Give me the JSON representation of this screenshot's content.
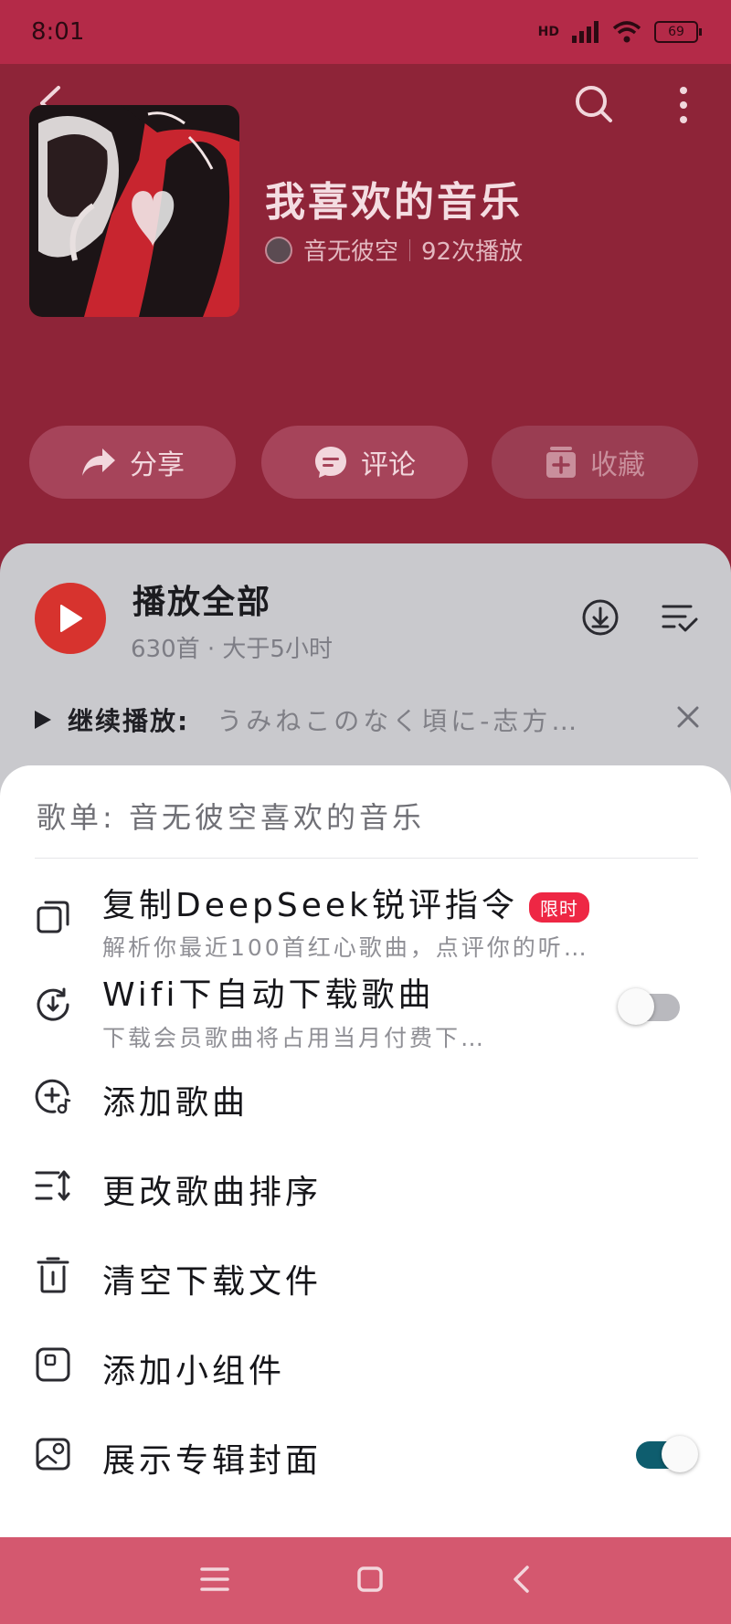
{
  "status": {
    "time": "8:01",
    "network": "HD",
    "battery": "69"
  },
  "header": {
    "playlist_title": "我喜欢的音乐",
    "creator_name": "音无彼空",
    "play_count": "92次播放",
    "actions": [
      {
        "label": "分享",
        "icon": "share-icon"
      },
      {
        "label": "评论",
        "icon": "comment-icon"
      },
      {
        "label": "收藏",
        "icon": "collect-icon"
      }
    ]
  },
  "player": {
    "play_all_label": "播放全部",
    "track_info": "630首 · 大于5小时",
    "continue_label": "继续播放:",
    "continue_song": "うみねこのなく頃に-志方…"
  },
  "menu": {
    "title": "歌单: 音无彼空喜欢的音乐",
    "items": [
      {
        "label": "复制DeepSeek锐评指令",
        "badge": "限时",
        "sub": "解析你最近100首红心歌曲，点评你的听…",
        "icon": "copy-icon"
      },
      {
        "label": "Wifi下自动下载歌曲",
        "sub": "下载会员歌曲将占用当月付费下…",
        "icon": "auto-download-icon",
        "toggle": false
      },
      {
        "label": "添加歌曲",
        "icon": "add-song-icon"
      },
      {
        "label": "更改歌曲排序",
        "icon": "sort-icon"
      },
      {
        "label": "清空下载文件",
        "icon": "trash-icon"
      },
      {
        "label": "添加小组件",
        "icon": "widget-icon"
      },
      {
        "label": "展示专辑封面",
        "icon": "album-cover-icon",
        "toggle": true
      }
    ]
  },
  "colors": {
    "header_bg": "#8e2438",
    "status_bg": "#b42a48",
    "accent_red": "#d7332e",
    "badge_red": "#ee2744",
    "toggle_on": "#0e5d6e",
    "navbar_bg": "#d4586f"
  }
}
